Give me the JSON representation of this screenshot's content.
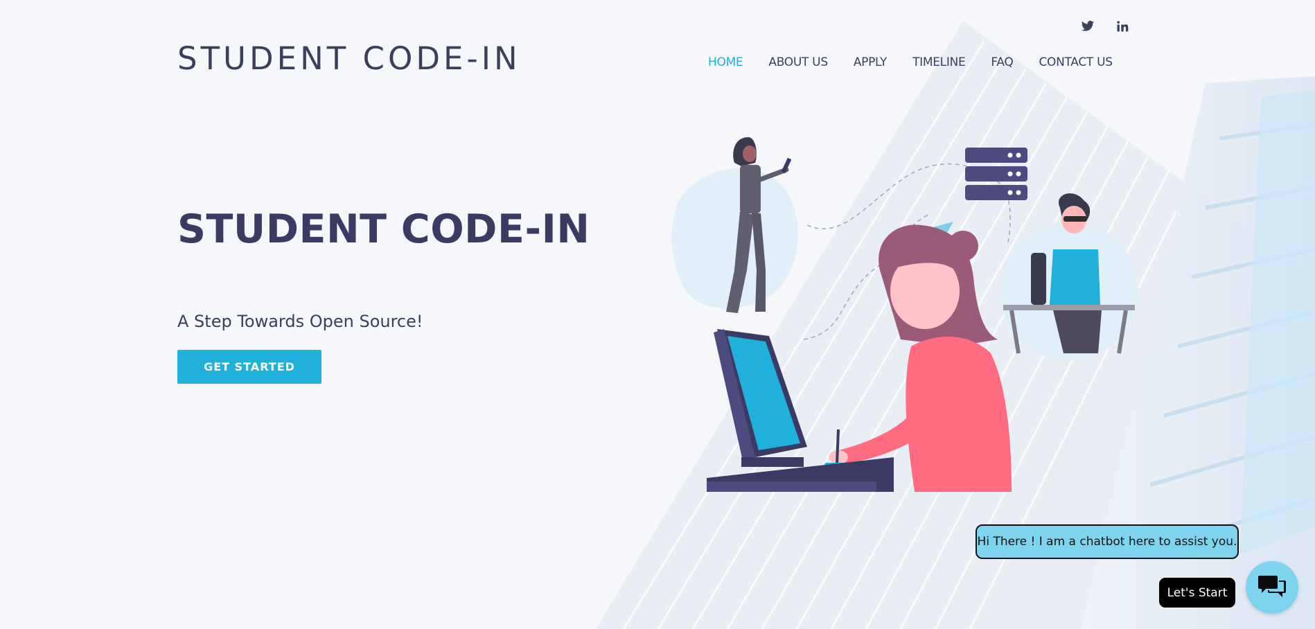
{
  "social": [
    {
      "icon": "twitter-icon"
    },
    {
      "icon": "linkedin-icon"
    }
  ],
  "logo": "STUDENT CODE-IN",
  "nav": [
    {
      "label": "HOME",
      "active": true
    },
    {
      "label": "ABOUT US"
    },
    {
      "label": "APPLY"
    },
    {
      "label": "TIMELINE"
    },
    {
      "label": "FAQ"
    },
    {
      "label": "CONTACT US"
    }
  ],
  "hero": {
    "title": "STUDENT CODE-IN",
    "subtitle": "A Step Towards Open Source!",
    "cta": "GET STARTED"
  },
  "chatbot": {
    "greeting": "Hi There ! I am a chatbot here to assist you.",
    "start_label": "Let's Start",
    "launcher_icon": "chat-icon"
  },
  "colors": {
    "accent": "#1fb1dc",
    "text": "#3a3f5c",
    "background": "#f5f7fb",
    "chat_bubble": "#7ed3ef"
  }
}
